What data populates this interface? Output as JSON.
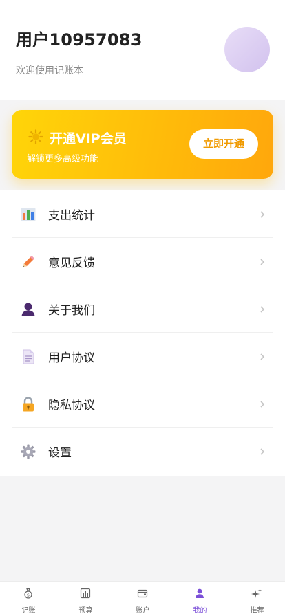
{
  "profile": {
    "username": "用户10957083",
    "subtitle": "欢迎使用记账本"
  },
  "vip": {
    "title": "开通VIP会员",
    "description": "解锁更多高级功能",
    "button_label": "立即开通",
    "accent_color": "#ffbc0a"
  },
  "menu": {
    "items": [
      {
        "label": "支出统计",
        "icon": "bar-chart-icon"
      },
      {
        "label": "意见反馈",
        "icon": "pencil-icon"
      },
      {
        "label": "关于我们",
        "icon": "person-icon"
      },
      {
        "label": "用户协议",
        "icon": "document-icon"
      },
      {
        "label": "隐私协议",
        "icon": "lock-icon"
      },
      {
        "label": "设置",
        "icon": "gear-icon"
      }
    ]
  },
  "tabbar": {
    "active_color": "#7b4fd8",
    "tabs": [
      {
        "label": "记账",
        "icon": "money-bag-icon",
        "active": false
      },
      {
        "label": "预算",
        "icon": "bar-chart-icon",
        "active": false
      },
      {
        "label": "账户",
        "icon": "wallet-icon",
        "active": false
      },
      {
        "label": "我的",
        "icon": "person-icon",
        "active": true
      },
      {
        "label": "推荐",
        "icon": "sparkle-icon",
        "active": false
      }
    ]
  }
}
